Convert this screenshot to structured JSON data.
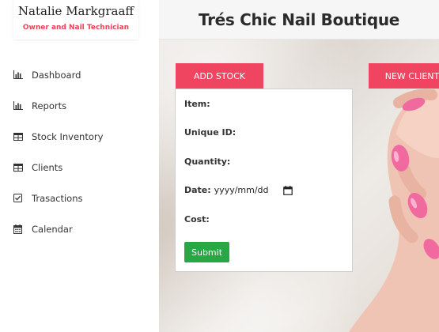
{
  "brand": {
    "name": "Natalie Markgraaff",
    "role": "Owner and Nail Technician"
  },
  "header": {
    "title": "Trés Chic Nail Boutique"
  },
  "sidebar": {
    "items": [
      {
        "label": "Dashboard",
        "icon": "bar-chart-icon"
      },
      {
        "label": "Reports",
        "icon": "bar-chart-icon"
      },
      {
        "label": "Stock Inventory",
        "icon": "table-icon"
      },
      {
        "label": "Clients",
        "icon": "table-icon"
      },
      {
        "label": "Trasactions",
        "icon": "checkbox-icon"
      },
      {
        "label": "Calendar",
        "icon": "calendar-icon"
      }
    ]
  },
  "actions": {
    "add_stock": "ADD STOCK",
    "new_client": "NEW CLIENT"
  },
  "form": {
    "item_label": "Item:",
    "unique_id_label": "Unique ID:",
    "quantity_label": "Quantity:",
    "date_label": "Date:",
    "date_value": "yyyy/mm/dd",
    "cost_label": "Cost:",
    "submit_label": "Submit"
  },
  "colors": {
    "accent_pink": "#ef4560",
    "submit_green": "#28a745",
    "role_text": "#e9435a"
  }
}
